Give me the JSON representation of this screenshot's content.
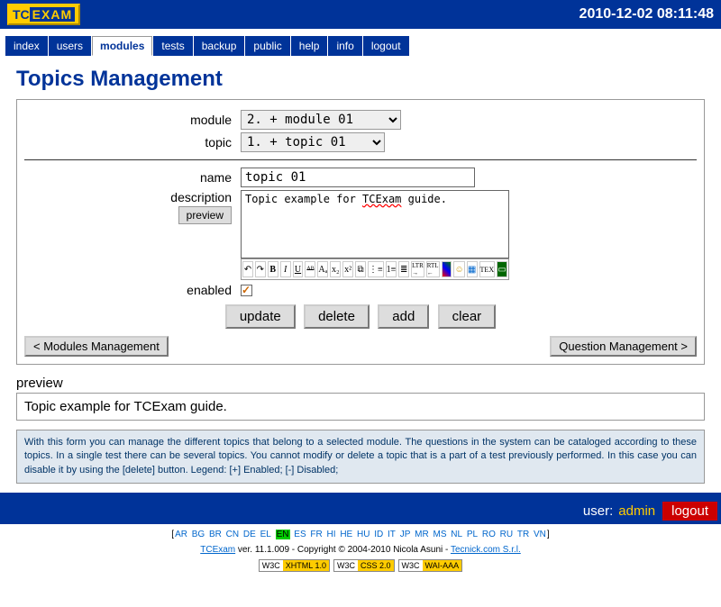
{
  "header": {
    "timestamp": "2010-12-02 08:11:48",
    "logo_prefix": "TC",
    "logo_text": "EXAM"
  },
  "nav": [
    "index",
    "users",
    "modules",
    "tests",
    "backup",
    "public",
    "help",
    "info",
    "logout"
  ],
  "nav_active": 2,
  "page_title": "Topics Management",
  "labels": {
    "module": "module",
    "topic": "topic",
    "name": "name",
    "description": "description",
    "preview_btn": "preview",
    "enabled": "enabled"
  },
  "fields": {
    "module": "2. + module 01",
    "topic": "1. + topic 01",
    "name": "topic 01",
    "description_pre": "Topic example for ",
    "description_err": "TCExam",
    "description_post": " guide."
  },
  "actions": {
    "update": "update",
    "delete": "delete",
    "add": "add",
    "clear": "clear"
  },
  "nav_buttons": {
    "prev": "< Modules Management",
    "next": "Question Management >"
  },
  "preview": {
    "label": "preview",
    "text": "Topic example for TCExam guide."
  },
  "help": "With this form you can manage the different topics that belong to a selected module. The questions in the system can be cataloged according to these topics. In a single test there can be several topics. You cannot modify or delete a topic that is a part of a test previously performed. In this case you can disable it by using the [delete] button. Legend: [+] Enabled; [-] Disabled;",
  "footer": {
    "user_label": "user:",
    "user": "admin",
    "logout": "logout",
    "langs": [
      "AR",
      "BG",
      "BR",
      "CN",
      "DE",
      "EL",
      "EN",
      "ES",
      "FR",
      "HI",
      "HE",
      "HU",
      "ID",
      "IT",
      "JP",
      "MR",
      "MS",
      "NL",
      "PL",
      "RO",
      "RU",
      "TR",
      "VN"
    ],
    "lang_active": "EN",
    "copyright_app": "TCExam",
    "copyright_text": " ver. 11.1.009 - Copyright © 2004-2010 Nicola Asuni - ",
    "copyright_link": "Tecnick.com S.r.l.",
    "badges": [
      [
        "W3C",
        "XHTML 1.0"
      ],
      [
        "W3C",
        "CSS 2.0"
      ],
      [
        "W3C",
        "WAI-AAA"
      ]
    ]
  }
}
